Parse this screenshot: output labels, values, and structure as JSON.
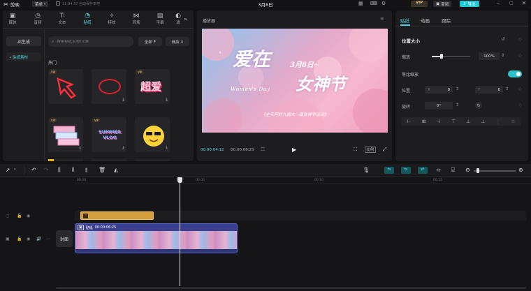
{
  "app": {
    "logo": "剪映",
    "menu_label": "菜单",
    "autosave": "11:04:37 自动保存本地",
    "title": "3月8日",
    "vip_badge": "VIP",
    "review_label": "审阅",
    "export_label": "导出"
  },
  "media_tools": [
    {
      "label": "媒体",
      "icon": "media-icon"
    },
    {
      "label": "音频",
      "icon": "audio-icon"
    },
    {
      "label": "文本",
      "icon": "text-icon"
    },
    {
      "label": "贴纸",
      "icon": "sticker-icon",
      "active": true
    },
    {
      "label": "特效",
      "icon": "effects-icon"
    },
    {
      "label": "转场",
      "icon": "transition-icon"
    },
    {
      "label": "字幕",
      "icon": "captions-icon"
    },
    {
      "label": "滤",
      "icon": "filter-icon"
    }
  ],
  "sidebar": {
    "ai_label": "AI生成",
    "material_label": "• 贴纸素材"
  },
  "stickers": {
    "search_placeholder": "搜索贴纸名称/元素",
    "all_label": "全部",
    "shop_label": "商店",
    "section_title": "热门",
    "vip_label": "VIP",
    "items": [
      {
        "name": "red-arrow-sticker"
      },
      {
        "name": "red-circle-sticker"
      },
      {
        "name": "pink-3d-text-sticker",
        "text": "超爱"
      },
      {
        "name": "pink-windows-sticker"
      },
      {
        "name": "summer-vlog-sticker",
        "text": "SUMMER VLOG"
      },
      {
        "name": "sunglasses-emoji-sticker"
      }
    ]
  },
  "player": {
    "title": "播放器",
    "headline": "爱在",
    "date_text": "3月8日~",
    "womens_day": "Women's Day",
    "goddess_text": "女神节",
    "subtitle": "《全天阿的九园大一瓶女神节活动》",
    "current_time": "00:00:04:12",
    "total_time": "00:00:06:25",
    "ratio_label": "比例"
  },
  "properties": {
    "tabs": [
      "贴纸",
      "动画",
      "跟踪"
    ],
    "active_tab": 0,
    "section_title": "位置大小",
    "scale_label": "缩放",
    "scale_value": "100%",
    "scale_fraction": 0.25,
    "uniform_scale_label": "等比缩放",
    "uniform_scale_on": true,
    "position_label": "位置",
    "x_label": "X",
    "x_value": "0",
    "y_label": "Y",
    "y_value": "0",
    "rotation_label": "旋转",
    "rotation_value": "0°"
  },
  "timeline": {
    "ticks": [
      "00:00",
      "00:05",
      "00:10",
      "00:15"
    ],
    "playhead_fraction": 0.66,
    "cover_label": "封面",
    "video_clip_label": "贴纸",
    "video_clip_duration": "00:00:06:25"
  },
  "colors": {
    "accent": "#4fd2e0",
    "export": "#1fc7d4",
    "sticker_clip": "#d4a03c",
    "video_clip": "#3a3f8f"
  }
}
